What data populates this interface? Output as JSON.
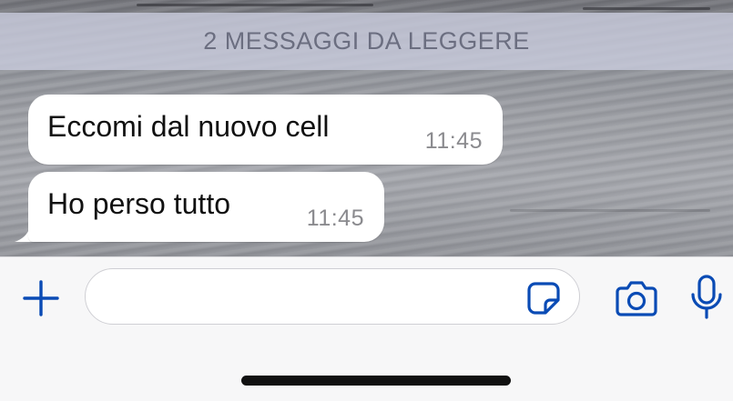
{
  "banner": {
    "unread_text": "2 MESSAGGI DA LEGGERE"
  },
  "messages": [
    {
      "text": "Eccomi dal nuovo cell",
      "time": "11:45"
    },
    {
      "text": "Ho perso tutto",
      "time": "11:45"
    }
  ],
  "composer": {
    "input_value": "",
    "icons": [
      "plus-icon",
      "sticker-icon",
      "camera-icon",
      "microphone-icon"
    ],
    "accent_color": "#0a4bb5"
  }
}
